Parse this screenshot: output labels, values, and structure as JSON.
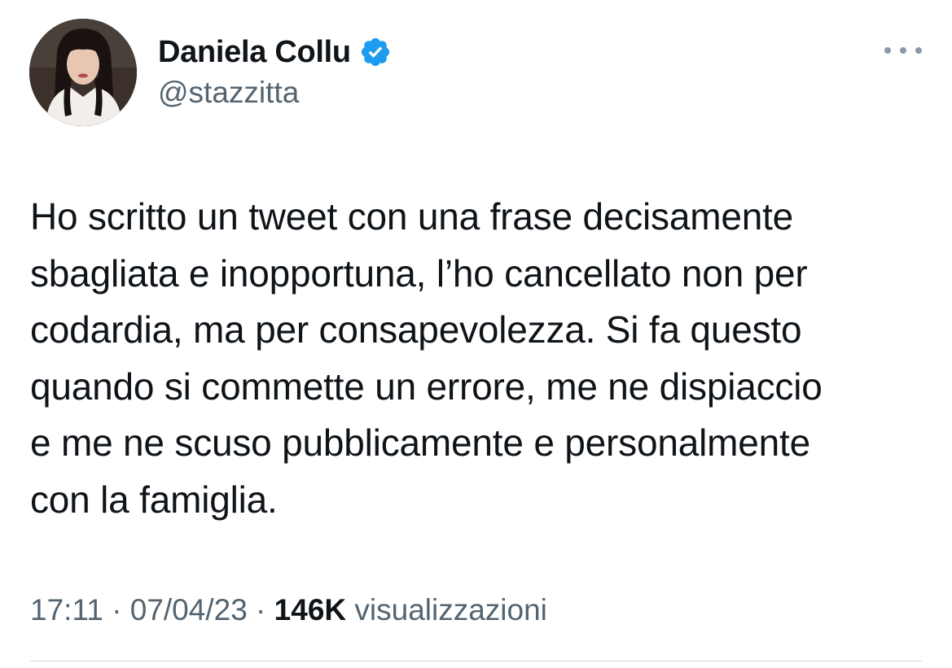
{
  "author": {
    "display_name": "Daniela Collu",
    "handle": "@stazzitta",
    "verified": true,
    "verified_badge_color": "#1d9bf0",
    "avatar_icon": "profile-photo"
  },
  "tweet": {
    "text_lines": [
      "Ho scritto un tweet con una frase decisamente",
      "sbagliata e inopportuna, l’ho cancellato non per",
      "codardia, ma per consapevolezza. Si fa questo",
      "quando si commette un errore, me ne dispiaccio",
      "e me ne scuso pubblicamente e personalmente",
      "con la famiglia."
    ]
  },
  "meta": {
    "time": "17:11",
    "separator": " · ",
    "date": "07/04/23",
    "views_count": "146K",
    "views_label": " visualizzazioni"
  },
  "menu": {
    "icon": "more-horizontal-icon"
  },
  "colors": {
    "text_primary": "#0f1419",
    "text_secondary": "#536471",
    "divider": "#cfd9de"
  }
}
